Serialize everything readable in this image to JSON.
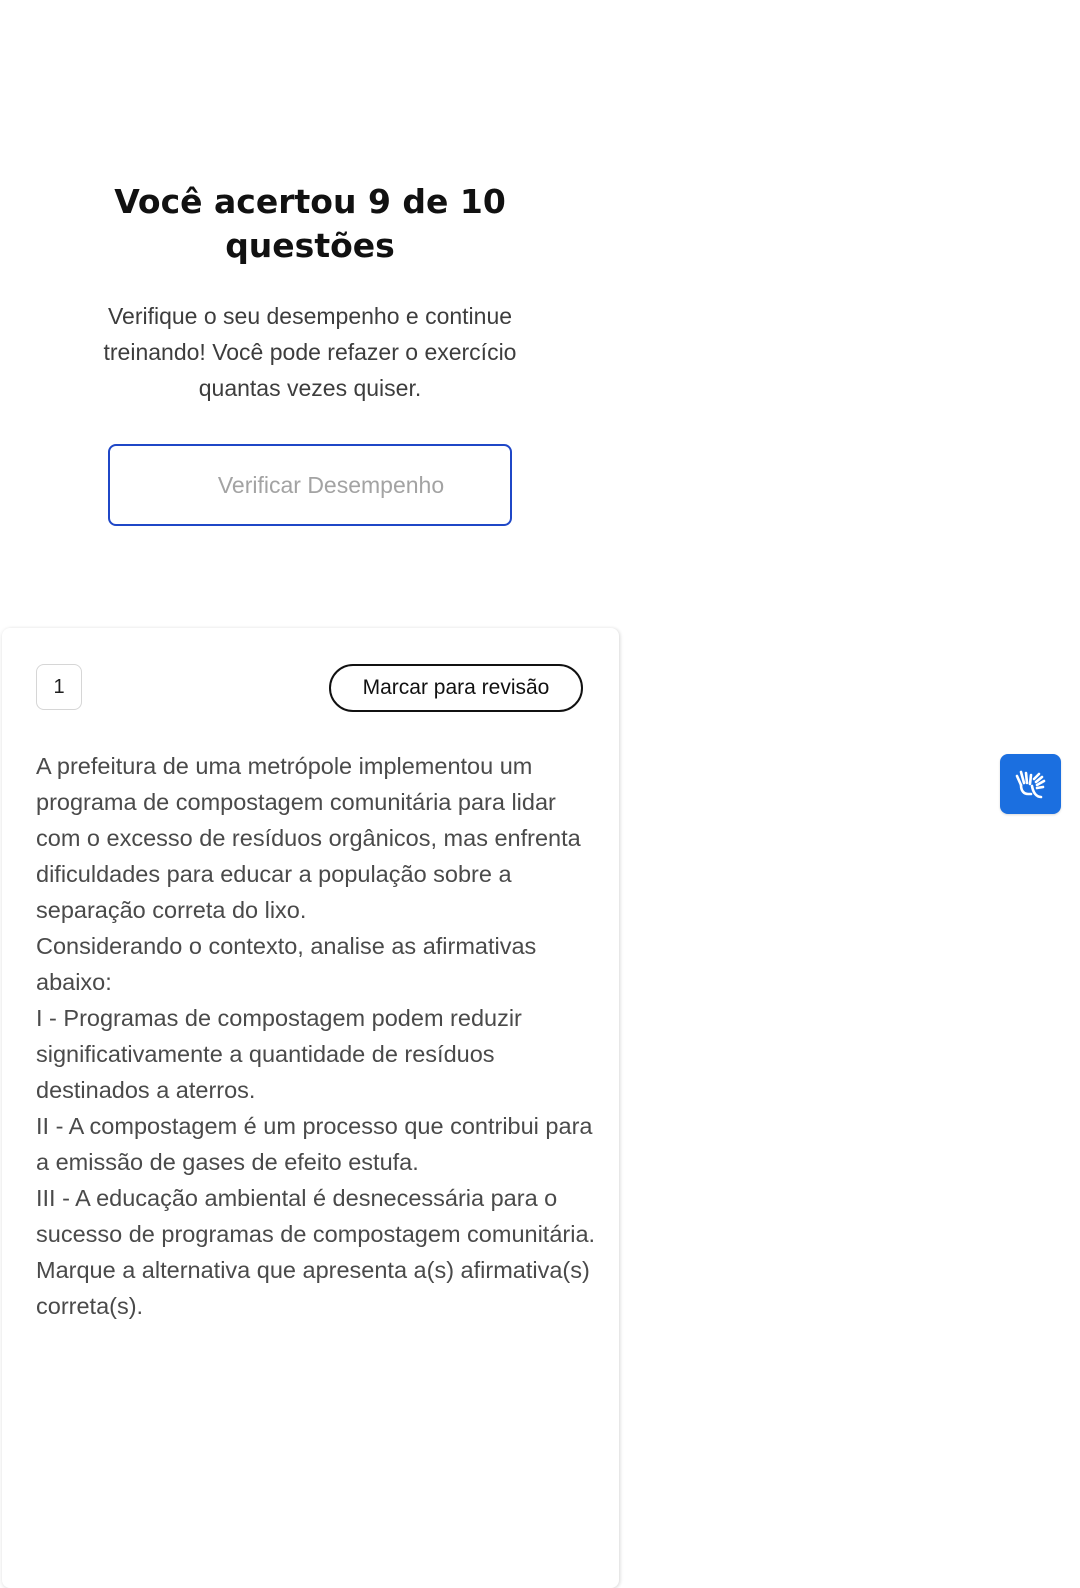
{
  "result": {
    "title": "Você acertou 9 de 10 questões",
    "subtitle": "Verifique o seu desempenho e continue treinando! Você pode refazer o exercício quantas vezes quiser.",
    "verify_button_label": "Verificar Desempenho"
  },
  "question": {
    "number": "1",
    "review_button_label": "Marcar para revisão",
    "paragraphs": [
      "A prefeitura de uma metrópole implementou um programa de compostagem comunitária para lidar com o excesso de resíduos orgânicos, mas enfrenta dificuldades para educar a população sobre a separação correta do lixo.",
      "Considerando o contexto, analise as afirmativas abaixo:",
      "I - Programas de compostagem podem reduzir significativamente a quantidade de resíduos destinados a aterros.",
      "II - A compostagem é um processo que contribui para a emissão de gases de efeito estufa.",
      "III - A educação ambiental é desnecessária para o sucesso de programas de compostagem comunitária.",
      "Marque a alternativa que apresenta a(s) afirmativa(s) correta(s)."
    ]
  },
  "accessibility": {
    "icon": "sign-language-hands-icon",
    "color": "#1b6fe0"
  },
  "colors": {
    "primary_border": "#1f47c7",
    "button_text_muted": "#a3a3a3",
    "body_text": "#4a4a4a"
  }
}
